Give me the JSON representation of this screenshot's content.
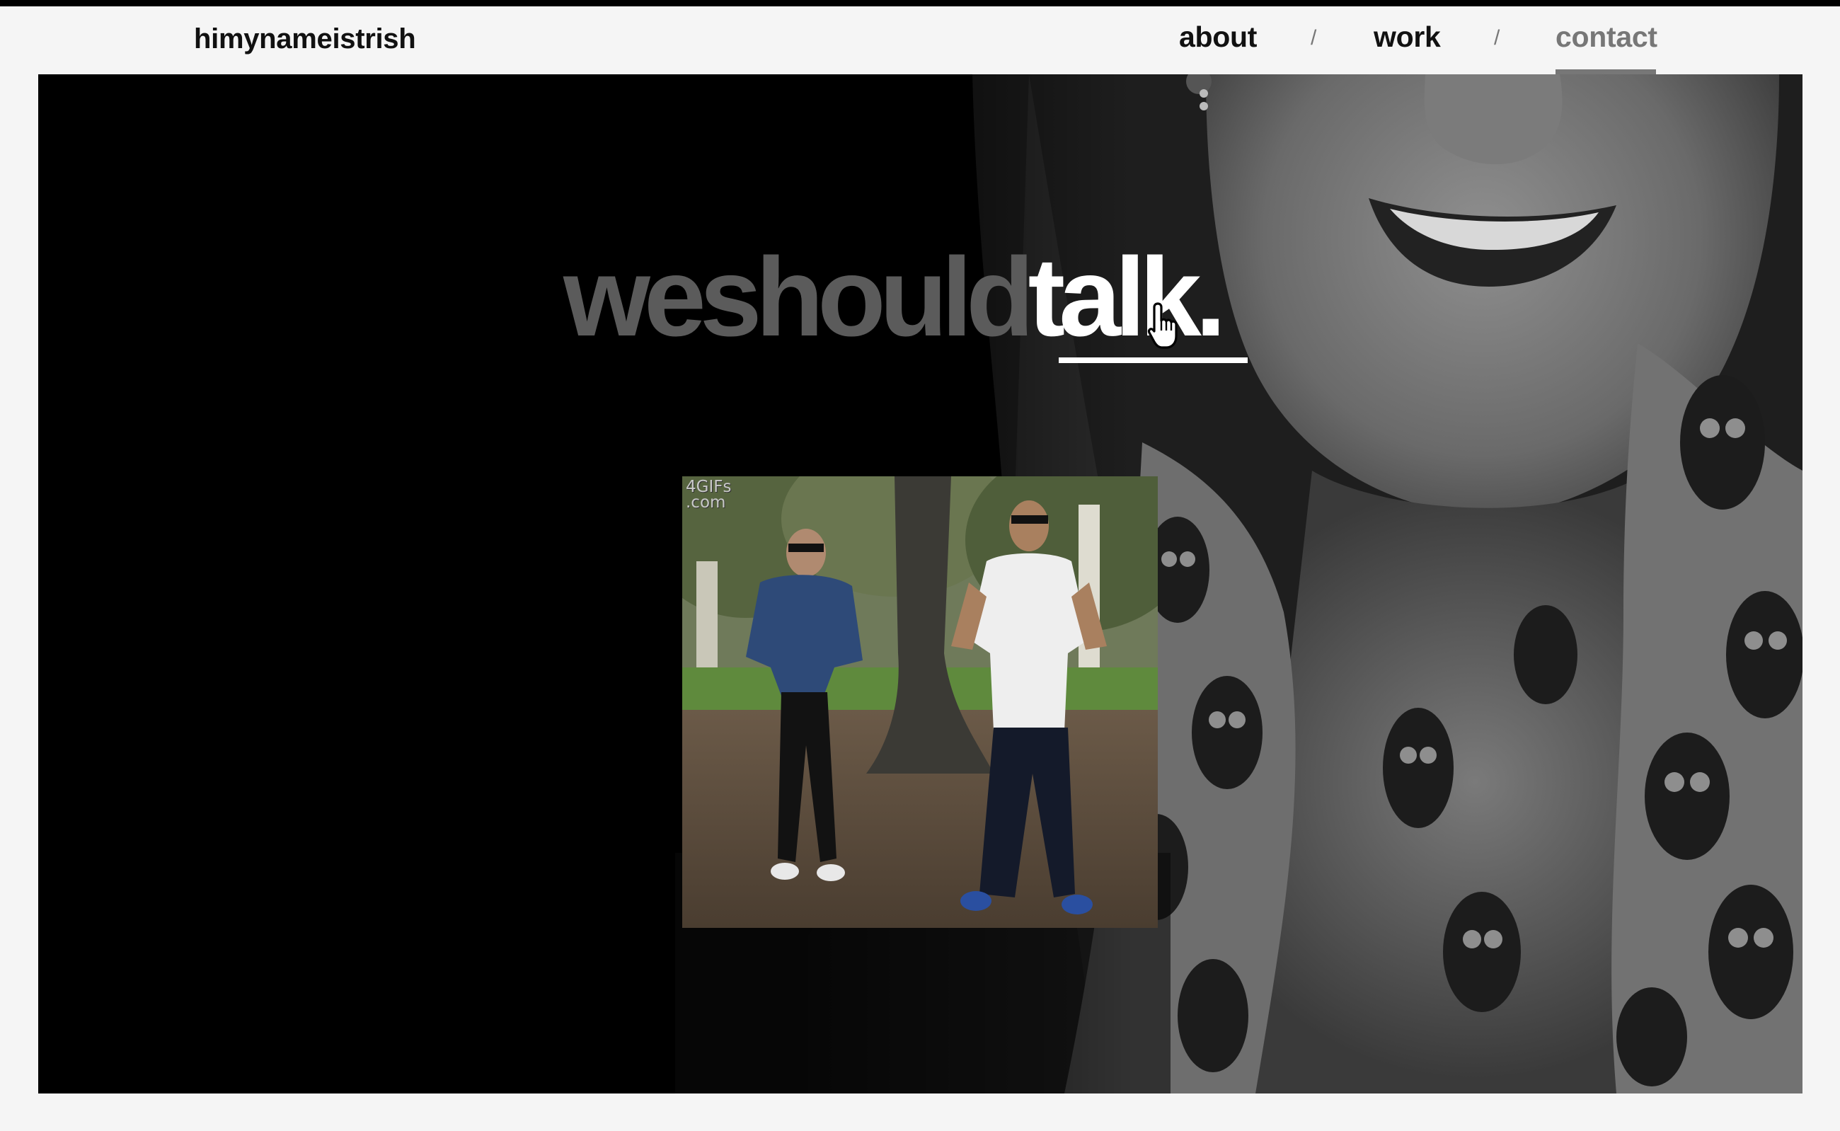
{
  "site": {
    "title": "himynameistrish"
  },
  "nav": {
    "items": [
      {
        "label": "about",
        "active": false
      },
      {
        "label": "work",
        "active": false
      },
      {
        "label": "contact",
        "active": true
      }
    ],
    "separator": "/"
  },
  "hero": {
    "headline_dim": "weshould",
    "headline_bright": "talk.",
    "gif": {
      "watermark_line1": "4GIFs",
      "watermark_line2": ".com"
    }
  },
  "colors": {
    "background": "#f5f5f5",
    "hero_background": "#000000",
    "text_dark": "#111111",
    "text_muted": "#777777",
    "headline_dim": "#5b5b5b",
    "headline_bright": "#ffffff"
  },
  "icons": {
    "cursor": "hand-pointer-icon"
  }
}
